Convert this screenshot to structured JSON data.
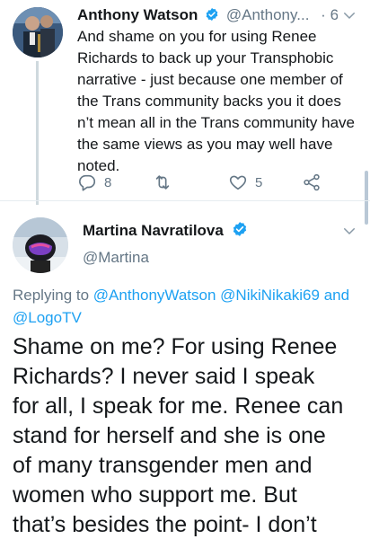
{
  "reply_tweet": {
    "author_name": "Anthony Watson",
    "author_handle": "@Anthony...",
    "separator": "·",
    "time": "6h",
    "body_lines": [
      "And shame on you for using Renee",
      "Richards to back up your Transphobic",
      "narrative - just because one member of",
      "the Trans community backs you it does",
      "n’t mean all in the Trans community have",
      "the same views as you may well have",
      "noted."
    ],
    "reply_count": "8",
    "retweet_count": "",
    "like_count": "5",
    "icons": [
      "verified-badge-icon",
      "chevron-down-icon",
      "reply-icon",
      "retweet-icon",
      "heart-icon",
      "share-icon"
    ]
  },
  "main_tweet": {
    "author_name": "Martina Navratilova",
    "author_handle": "@Martina",
    "replying_prefix": "Replying to",
    "mentions": [
      "@AnthonyWatson",
      "@NikiNikaki69",
      "and",
      "@LogoTV"
    ],
    "body_lines": [
      "Shame on me? For using Renee",
      "Richards? I never said I speak",
      "for all, I speak for me. Renee can",
      "stand for herself and she is one",
      "of many transgender men and",
      "women who support me. But",
      "that’s besides the point- I don’t"
    ]
  },
  "colors": {
    "accent": "#1da1f2",
    "text": "#14171a",
    "secondary": "#657786",
    "divider": "#e6ecf0"
  }
}
